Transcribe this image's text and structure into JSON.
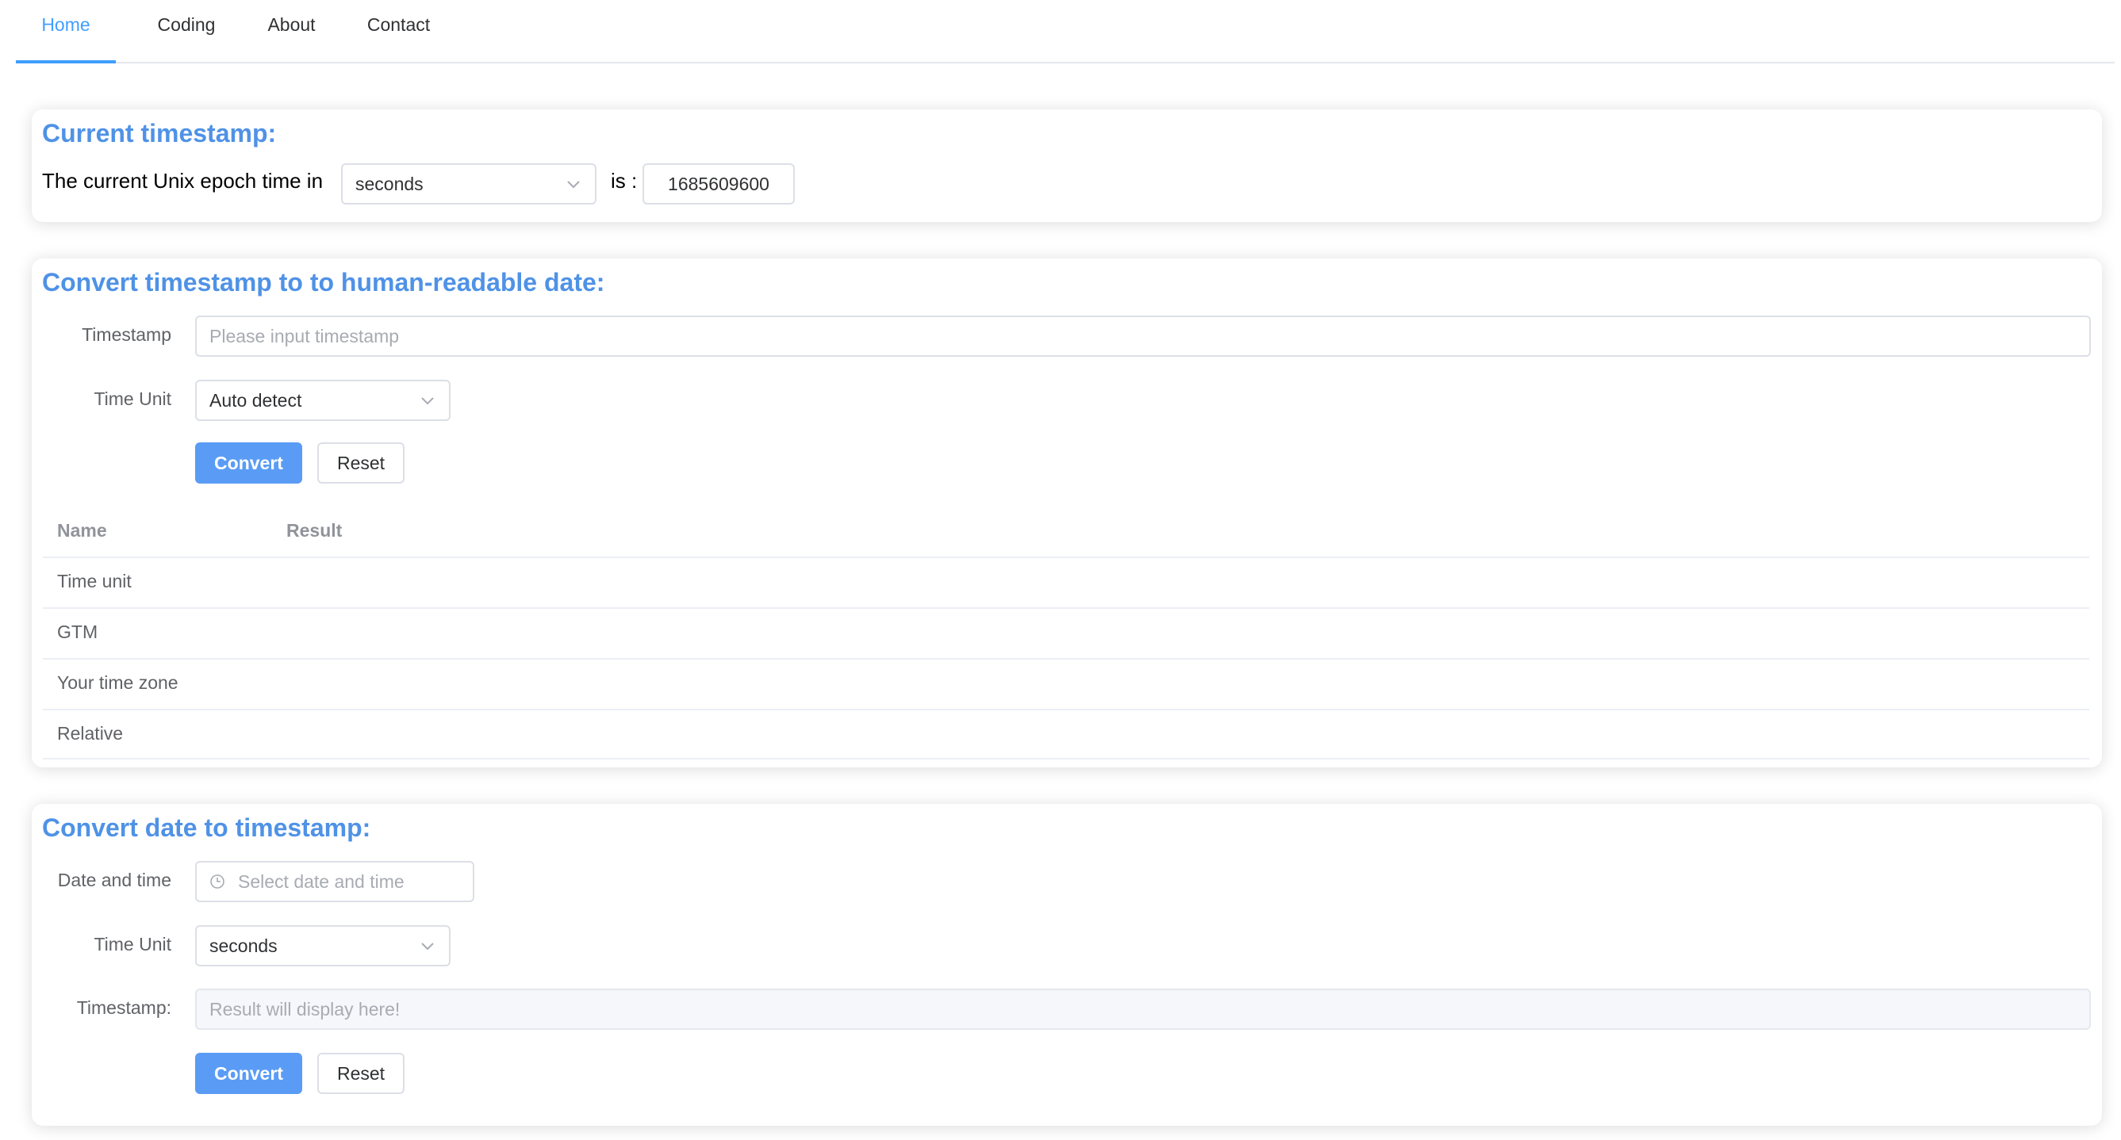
{
  "nav": {
    "items": [
      {
        "label": "Home",
        "active": true
      },
      {
        "label": "Coding",
        "active": false
      },
      {
        "label": "About",
        "active": false
      },
      {
        "label": "Contact",
        "active": false
      }
    ]
  },
  "current": {
    "title": "Current timestamp:",
    "prefix": "The current Unix epoch time in",
    "unit": "seconds",
    "is_label": "is :",
    "value": "1685609600"
  },
  "to_date": {
    "title": "Convert timestamp to to human-readable date:",
    "timestamp_label": "Timestamp",
    "timestamp_placeholder": "Please input timestamp",
    "unit_label": "Time Unit",
    "unit_value": "Auto detect",
    "convert_label": "Convert",
    "reset_label": "Reset",
    "table": {
      "headers": [
        "Name",
        "Result"
      ],
      "rows": [
        "Time unit",
        "GTM",
        "Your time zone",
        "Relative"
      ]
    }
  },
  "to_timestamp": {
    "title": "Convert date to timestamp:",
    "date_label": "Date and time",
    "date_placeholder": "Select date and time",
    "unit_label": "Time Unit",
    "unit_value": "seconds",
    "result_label": "Timestamp:",
    "result_placeholder": "Result will display here!",
    "convert_label": "Convert",
    "reset_label": "Reset"
  },
  "colors": {
    "accent": "#409eff",
    "title": "#4f92e6",
    "primary_button": "#5a9cf5"
  }
}
